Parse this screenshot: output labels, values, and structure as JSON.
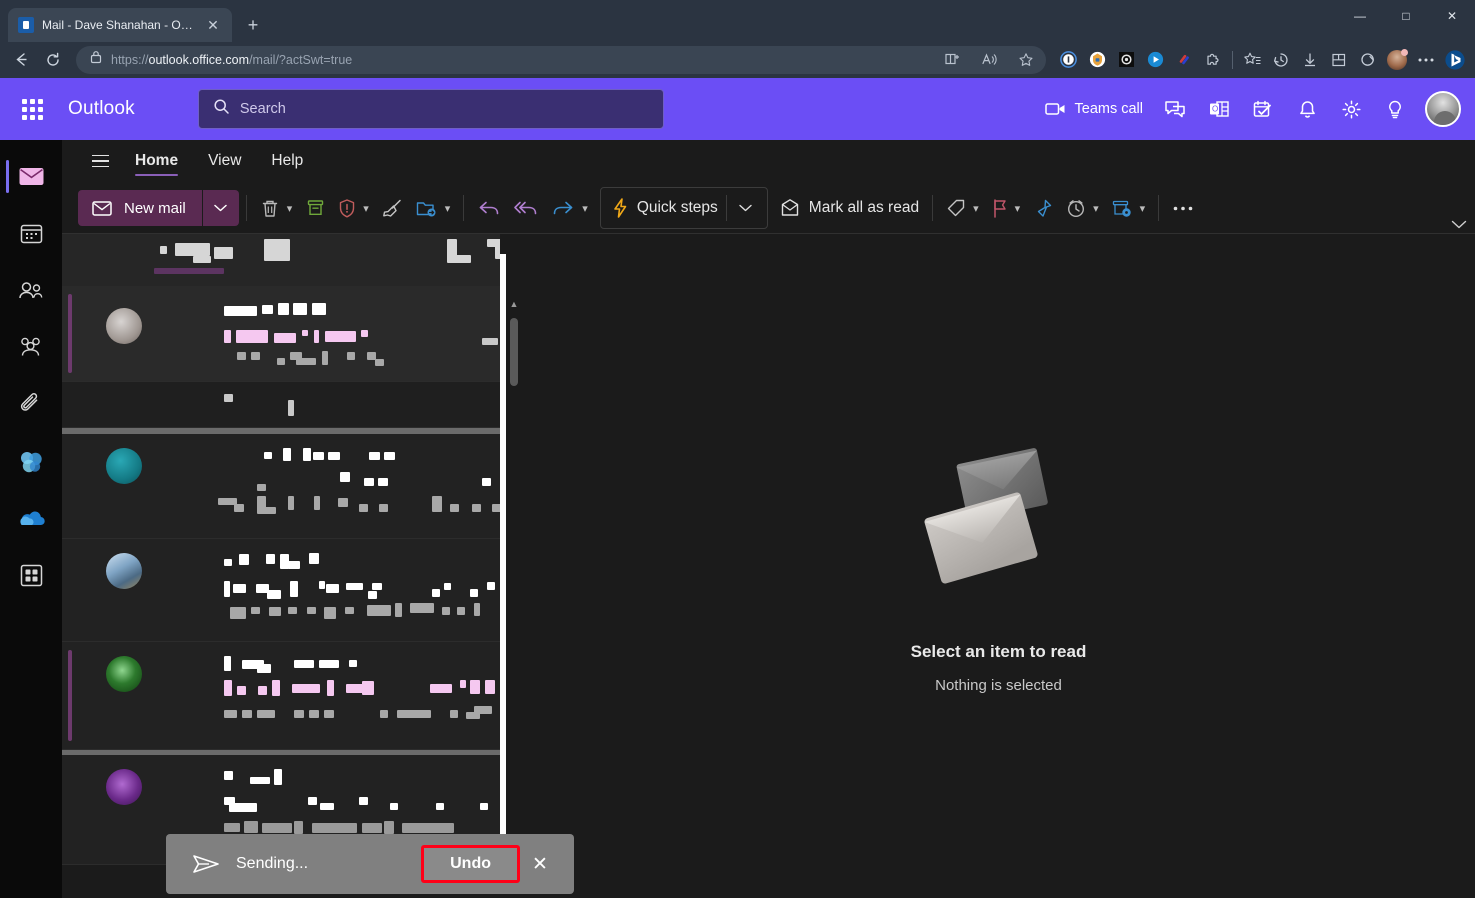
{
  "browser": {
    "tab": {
      "title": "Mail - Dave Shanahan - Outlook",
      "close_icon": "close-icon",
      "favicon": "outlook-favicon"
    },
    "new_tab_label": "+",
    "window": {
      "minimize": "—",
      "maximize": "□",
      "close": "✕"
    },
    "nav": {
      "back": "←",
      "reload": "↻",
      "lock_icon": "lock-icon"
    },
    "url": {
      "scheme": "https://",
      "host": "outlook.office.com",
      "path": "/mail/?actSwt=true"
    },
    "omnibox_icons": [
      "split-screen-icon",
      "read-aloud-icon",
      "favorite-star-icon"
    ],
    "toolbar_icons": [
      "onenote-clipper-icon",
      "password-manager-icon",
      "adblock-icon",
      "video-download-icon",
      "link-icon",
      "extensions-puzzle-icon",
      "favorites-icon",
      "history-icon",
      "downloads-icon",
      "collections-icon",
      "copilot-pen-icon",
      "profile-avatar",
      "settings-more-icon",
      "bing-icon"
    ]
  },
  "outlook": {
    "brand": "Outlook",
    "waffle_icon": "app-launcher-icon",
    "search": {
      "placeholder": "Search",
      "value": "",
      "icon": "search-icon"
    },
    "header_actions": [
      {
        "name": "teams-call",
        "label": "Teams call",
        "icon": "video-camera-icon"
      },
      {
        "name": "chat",
        "label": "",
        "icon": "chat-icon"
      },
      {
        "name": "outlook-app",
        "label": "",
        "icon": "outlook-app-icon"
      },
      {
        "name": "to-do",
        "label": "",
        "icon": "todo-checklist-icon"
      },
      {
        "name": "notifications",
        "label": "",
        "icon": "bell-icon"
      },
      {
        "name": "settings",
        "label": "",
        "icon": "gear-icon"
      },
      {
        "name": "tips",
        "label": "",
        "icon": "lightbulb-icon"
      }
    ],
    "account_avatar": "user-avatar"
  },
  "rail": {
    "items": [
      {
        "name": "mail",
        "icon": "mail-icon",
        "active": true,
        "color": "#f0b6e8"
      },
      {
        "name": "calendar",
        "icon": "calendar-icon",
        "active": false,
        "color": "#d6d6d6"
      },
      {
        "name": "people",
        "icon": "people-icon",
        "active": false,
        "color": "#d6d6d6"
      },
      {
        "name": "groups",
        "icon": "groups-icon",
        "active": false,
        "color": "#d6d6d6"
      },
      {
        "name": "files",
        "icon": "paperclip-icon",
        "active": false,
        "color": "#d6d6d6"
      },
      {
        "name": "loop",
        "icon": "loop-icon",
        "active": false,
        "color": "#5aa8e8"
      },
      {
        "name": "onedrive",
        "icon": "onedrive-cloud-icon",
        "active": false,
        "color": "#2a8ad4"
      },
      {
        "name": "apps",
        "icon": "apps-grid-icon",
        "active": false,
        "color": "#d6d6d6"
      }
    ]
  },
  "ribbon": {
    "hamburger_icon": "hamburger-menu-icon",
    "tabs": [
      {
        "label": "Home",
        "active": true
      },
      {
        "label": "View",
        "active": false
      },
      {
        "label": "Help",
        "active": false
      }
    ],
    "expand_icon": "chevron-down-icon"
  },
  "toolbar": {
    "new_mail": {
      "label": "New mail",
      "icon": "envelope-icon",
      "caret": "⌄"
    },
    "buttons": [
      {
        "name": "delete",
        "icon": "trash-icon",
        "label": "",
        "caret": true,
        "color": "#b8b8b8"
      },
      {
        "name": "archive",
        "icon": "archive-box-icon",
        "label": "",
        "caret": false,
        "color": "#6fa83a"
      },
      {
        "name": "report",
        "icon": "shield-alert-icon",
        "label": "",
        "caret": true,
        "color": "#c15c5c"
      },
      {
        "name": "sweep",
        "icon": "broom-icon",
        "label": "",
        "caret": false,
        "color": "#c4c4c4"
      },
      {
        "name": "move-to",
        "icon": "folder-move-icon",
        "label": "",
        "caret": true,
        "color": "#3a8fd0"
      },
      {
        "name": "reply",
        "icon": "reply-arrow-icon",
        "label": "",
        "caret": false,
        "color": "#b07fd0"
      },
      {
        "name": "reply-all",
        "icon": "reply-all-arrow-icon",
        "label": "",
        "caret": false,
        "color": "#b07fd0"
      },
      {
        "name": "forward",
        "icon": "forward-arrow-icon",
        "label": "",
        "caret": true,
        "color": "#3a8fd0"
      }
    ],
    "quick_steps": {
      "label": "Quick steps",
      "icon": "lightning-bolt-icon",
      "caret": "⌄"
    },
    "mark_all_read": {
      "label": "Mark all as read",
      "icon": "mark-read-icon"
    },
    "right_buttons": [
      {
        "name": "categorize",
        "icon": "tag-icon",
        "caret": true,
        "color": "#c4c4c4"
      },
      {
        "name": "flag",
        "icon": "flag-icon",
        "caret": true,
        "color": "#c1566a"
      },
      {
        "name": "pin",
        "icon": "pin-icon",
        "caret": false,
        "color": "#3a8fd0"
      },
      {
        "name": "snooze",
        "icon": "clock-icon",
        "caret": true,
        "color": "#b8b8b8"
      },
      {
        "name": "rules",
        "icon": "rules-gear-icon",
        "caret": true,
        "color": "#3a8fd0"
      }
    ],
    "overflow": {
      "icon": "ellipsis-icon",
      "label": "•••"
    }
  },
  "message_list": {
    "header_redacted": true,
    "scrollbar": {
      "up_arrow": "▲",
      "down_arrow": "▼"
    },
    "rows": [
      {
        "name": "message-row-1",
        "avatar_color": "#b9b0ad",
        "selected": true,
        "unread": false,
        "redacted": true
      },
      {
        "name": "message-row-2",
        "avatar_color": "#1b1b1b",
        "selected": false,
        "unread": false,
        "redacted": true
      },
      {
        "name": "message-row-3",
        "avatar_color": "#147a85",
        "selected": false,
        "unread": false,
        "redacted": true
      },
      {
        "name": "message-row-4",
        "avatar_color": "#8fa8bd",
        "selected": false,
        "unread": false,
        "redacted": true
      },
      {
        "name": "message-row-5",
        "avatar_color": "#1d5c1d",
        "selected": false,
        "unread": true,
        "redacted": true
      },
      {
        "name": "message-row-6",
        "avatar_color": "#6b2a8a",
        "selected": false,
        "unread": false,
        "redacted": true
      }
    ]
  },
  "reading_pane": {
    "illustration": "two-envelopes-icon",
    "title": "Select an item to read",
    "subtitle": "Nothing is selected"
  },
  "toast": {
    "icon": "send-paper-plane-icon",
    "message": "Sending...",
    "undo_label": "Undo",
    "close_icon": "close-icon",
    "highlight_color": "#ff0018"
  }
}
